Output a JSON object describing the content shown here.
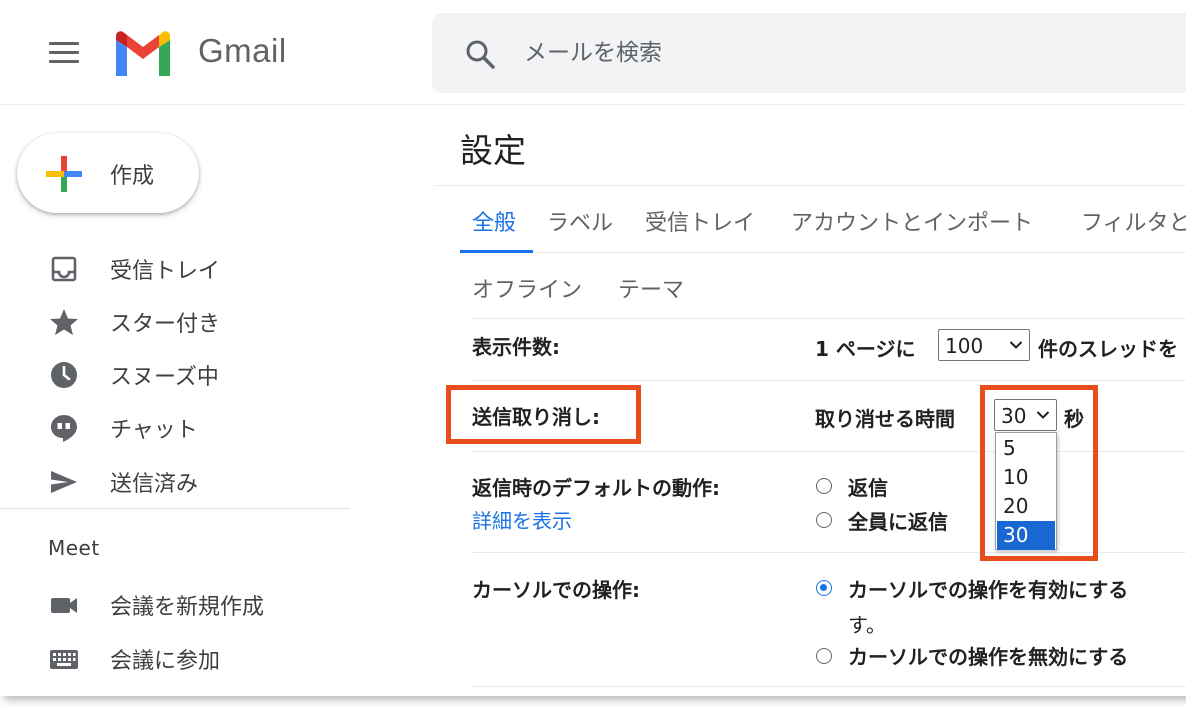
{
  "app": {
    "name": "Gmail"
  },
  "colors": {
    "accent": "#1a73e8",
    "highlight": "#e84e1b",
    "selected_option": "#1967d2"
  },
  "header": {
    "search_placeholder": "メールを検索"
  },
  "compose": {
    "label": "作成"
  },
  "sidebar": {
    "items": [
      {
        "label": "受信トレイ",
        "icon": "inbox-icon"
      },
      {
        "label": "スター付き",
        "icon": "star-icon"
      },
      {
        "label": "スヌーズ中",
        "icon": "clock-icon"
      },
      {
        "label": "チャット",
        "icon": "chat-icon"
      },
      {
        "label": "送信済み",
        "icon": "send-icon"
      }
    ],
    "meet": {
      "title": "Meet",
      "items": [
        {
          "label": "会議を新規作成",
          "icon": "video-camera-icon"
        },
        {
          "label": "会議に参加",
          "icon": "keyboard-icon"
        }
      ]
    }
  },
  "settings": {
    "title": "設定",
    "tabs": [
      "全般",
      "ラベル",
      "受信トレイ",
      "アカウントとインポート",
      "フィルタと",
      "オフライン",
      "テーマ"
    ],
    "active_tab": "全般",
    "rows": {
      "page_size": {
        "label": "表示件数:",
        "prefix": "1 ページに",
        "value": "100",
        "suffix": "件のスレッドを"
      },
      "undo_send": {
        "label": "送信取り消し:",
        "prefix": "取り消せる時間",
        "value": "30",
        "unit": "秒",
        "options": [
          "5",
          "10",
          "20",
          "30"
        ],
        "selected": "30"
      },
      "reply_default": {
        "label": "返信時のデフォルトの動作:",
        "link": "詳細を表示",
        "options": [
          "返信",
          "全員に返信"
        ]
      },
      "hover_actions": {
        "label": "カーソルでの操作:",
        "option_enable": "カーソルでの操作を有効にする",
        "enable_desc": "す。",
        "option_disable": "カーソルでの操作を無効にする"
      }
    }
  }
}
